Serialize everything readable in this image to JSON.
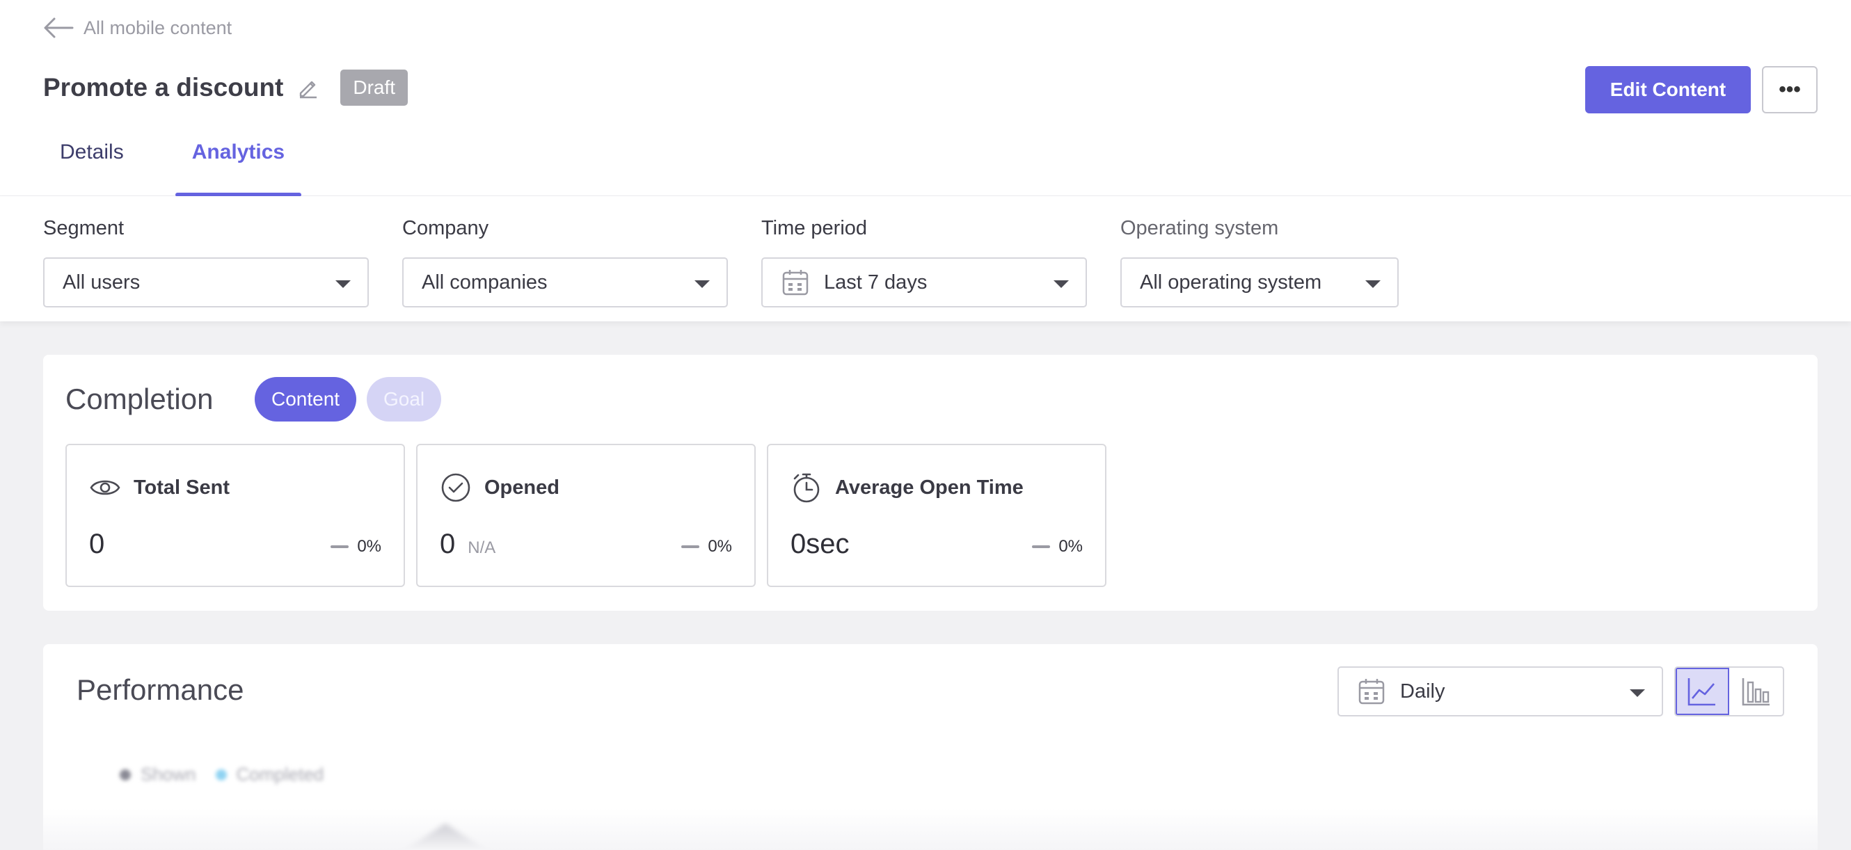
{
  "header": {
    "back_label": "All mobile content",
    "title": "Promote a discount",
    "status_badge": "Draft",
    "edit_button": "Edit Content",
    "more_button": "•••"
  },
  "tabs": [
    {
      "label": "Details",
      "active": false
    },
    {
      "label": "Analytics",
      "active": true
    }
  ],
  "filters": {
    "segment": {
      "label": "Segment",
      "value": "All users"
    },
    "company": {
      "label": "Company",
      "value": "All companies"
    },
    "time_period": {
      "label": "Time period",
      "value": "Last 7 days"
    },
    "operating_system": {
      "label": "Operating system",
      "value": "All operating system"
    }
  },
  "completion": {
    "title": "Completion",
    "pills": {
      "content": "Content",
      "goal": "Goal"
    },
    "stats": [
      {
        "label": "Total Sent",
        "value": "0",
        "extra": "",
        "change": "0%",
        "icon": "eye-icon"
      },
      {
        "label": "Opened",
        "value": "0",
        "extra": "N/A",
        "change": "0%",
        "icon": "check-circle-icon"
      },
      {
        "label": "Average Open Time",
        "value": "0sec",
        "extra": "",
        "change": "0%",
        "icon": "stopwatch-icon"
      }
    ]
  },
  "performance": {
    "title": "Performance",
    "granularity": "Daily",
    "legend": [
      "Shown",
      "Completed"
    ],
    "chart_modes": [
      "line-chart-icon",
      "bar-chart-icon"
    ],
    "active_mode": "line-chart-icon"
  },
  "colors": {
    "accent": "#6563e0",
    "accent_light": "#d5d4f5",
    "badge_gray": "#a8a8ae",
    "legend_shown": "#8a8a95",
    "legend_completed": "#8fd3f2"
  }
}
